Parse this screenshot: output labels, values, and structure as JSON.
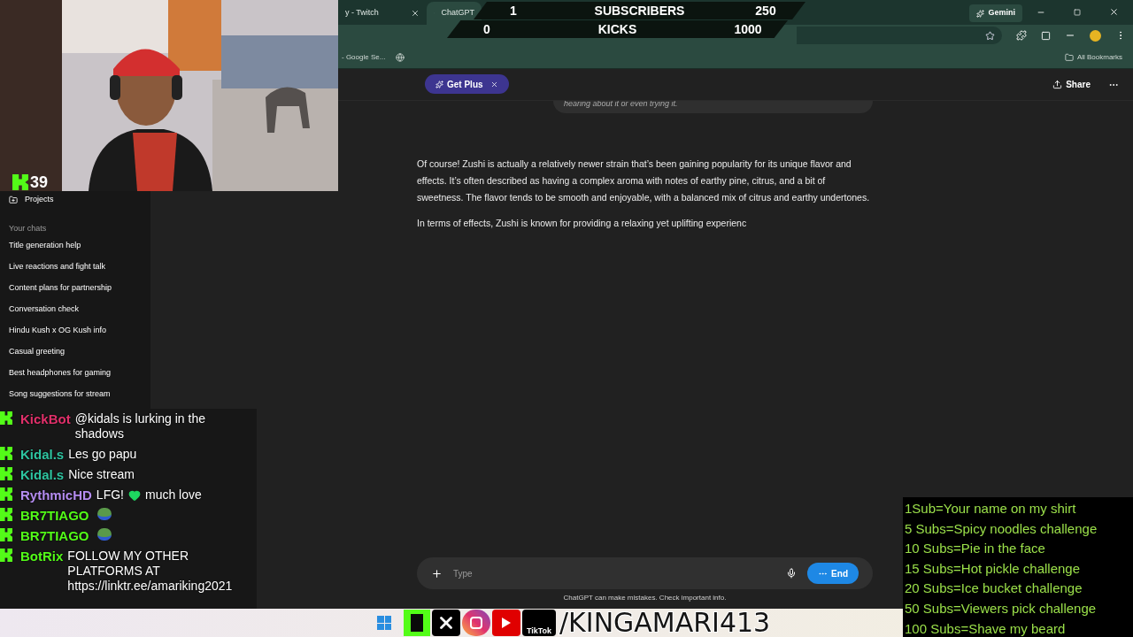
{
  "browser": {
    "tabs": [
      {
        "title": "y - Twitch",
        "selected": false
      },
      {
        "title": "ChatGPT",
        "selected": true
      }
    ],
    "gemini": "Gemini",
    "bookmarks": [
      "- Google Se..."
    ],
    "all_bookmarks": "All Bookmarks"
  },
  "sidebar": {
    "projects": "Projects",
    "section": "Your chats",
    "chats": [
      "Title generation help",
      "Live reactions and fight talk",
      "Content plans for partnership",
      "Conversation check",
      "Hindu Kush x OG Kush info",
      "Casual greeting",
      "Best headphones for gaming",
      "Song suggestions for stream"
    ]
  },
  "header": {
    "get_plus": "Get Plus",
    "share": "Share"
  },
  "conversation": {
    "user_message_tail": "hearing about it or even trying it.",
    "response": [
      "Of course! Zushi is actually a relatively newer strain that’s been gaining popularity for its unique flavor and effects. It’s often described as having a complex aroma with notes of earthy pine, citrus, and a bit of sweetness. The flavor tends to be smooth and enjoyable, with a balanced mix of citrus and earthy undertones.",
      "In terms of effects, Zushi is known for providing a relaxing yet uplifting experienc"
    ]
  },
  "composer": {
    "placeholder": "Type",
    "end": "End",
    "disclaimer": "ChatGPT can make mistakes. Check important info."
  },
  "stream": {
    "viewer_count": "39",
    "goal": [
      {
        "current": "1",
        "label": "SUBSCRIBERS",
        "target": "250"
      },
      {
        "current": "0",
        "label": "KICKS",
        "target": "1000"
      }
    ],
    "chat": [
      {
        "kind": "text",
        "user": "KickBot",
        "color": "#e0306a",
        "message": "@kidals is lurking in the shadows"
      },
      {
        "kind": "text",
        "user": "Kidal.s",
        "color": "#2ec4a0",
        "message": "Les go papu"
      },
      {
        "kind": "text",
        "user": "Kidal.s",
        "color": "#2ec4a0",
        "message": "Nice stream"
      },
      {
        "kind": "heart",
        "user": "RythmicHD",
        "color": "#b48cf0",
        "message": "LFG!",
        "message_after": "much love"
      },
      {
        "kind": "emote",
        "user": "BR7TIAGO",
        "color": "#53fc18"
      },
      {
        "kind": "emote",
        "user": "BR7TIAGO",
        "color": "#53fc18"
      },
      {
        "kind": "text",
        "user": "BotRix",
        "color": "#53fc18",
        "message": "FOLLOW MY OTHER PLATFORMS AT https://linktr.ee/amariking2021"
      }
    ],
    "handle": "/KINGAMARI413",
    "tiktok_label": "TikTok",
    "challenges": [
      "1Sub=Your name on my shirt",
      "5 Subs=Spicy noodles challenge",
      "10 Subs=Pie in the face",
      "15 Subs=Hot pickle challenge",
      "20 Subs=Ice bucket challenge",
      "50 Subs=Viewers pick challenge",
      "100 Subs=Shave my beard"
    ]
  }
}
